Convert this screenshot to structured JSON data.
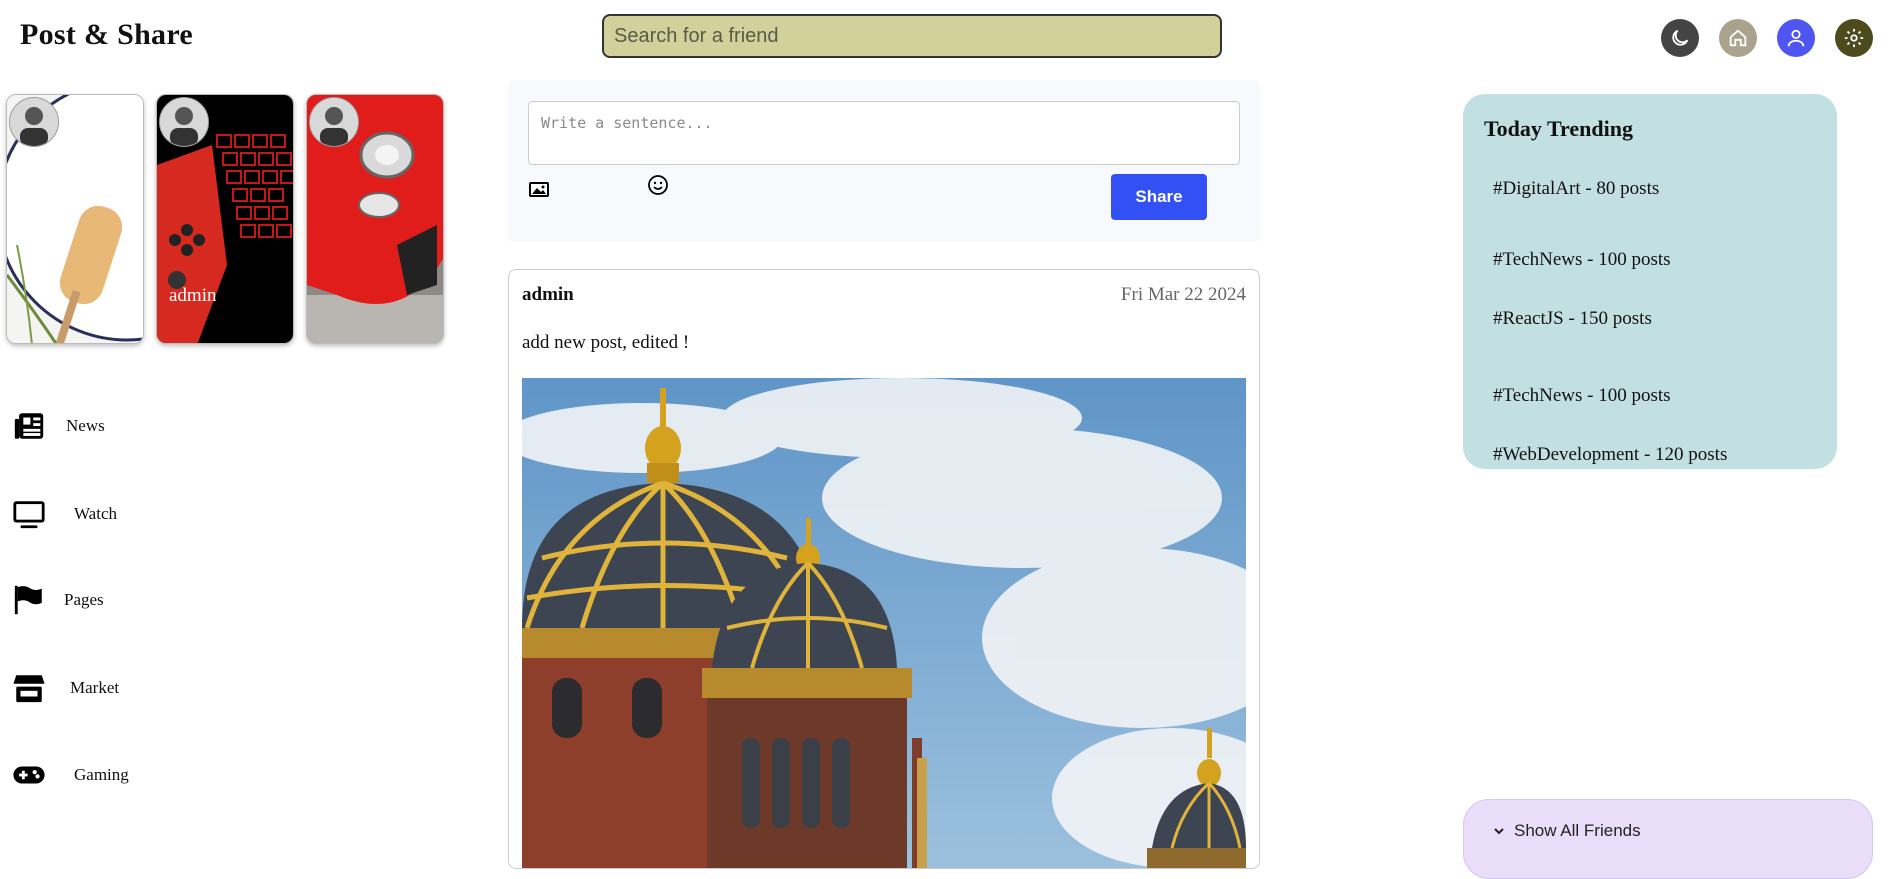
{
  "app": {
    "title": "Post & Share"
  },
  "search": {
    "placeholder": "Search for a friend"
  },
  "header_icons": [
    {
      "name": "dark-mode-icon",
      "color": "#444444"
    },
    {
      "name": "home-icon",
      "color": "#aaa28d"
    },
    {
      "name": "profile-icon",
      "color": "#4f55f0"
    },
    {
      "name": "settings-icon",
      "color": "#4d4b1e"
    }
  ],
  "stories": [
    {
      "name": "",
      "image": "popsicle-on-plate"
    },
    {
      "name": "admin",
      "image": "red-keyboard-gamepad"
    },
    {
      "name": "",
      "image": "red-car-headlight"
    }
  ],
  "nav": {
    "items": [
      {
        "label": "News",
        "icon": "newspaper-icon"
      },
      {
        "label": "Watch",
        "icon": "monitor-icon"
      },
      {
        "label": "Pages",
        "icon": "flag-icon"
      },
      {
        "label": "Market",
        "icon": "store-icon"
      },
      {
        "label": "Gaming",
        "icon": "gamepad-icon"
      }
    ]
  },
  "composer": {
    "placeholder": "Write a sentence...",
    "share_label": "Share",
    "image_icon": "image-icon",
    "emoji_icon": "emoji-icon",
    "accent": "#3350f5"
  },
  "post": {
    "author": "admin",
    "date": "Fri Mar 22 2024",
    "text": "add new post, edited !",
    "image": "golden-domed-synagogue"
  },
  "trending": {
    "title": "Today Trending",
    "items": [
      {
        "label": "#DigitalArt - 80 posts"
      },
      {
        "label": "#TechNews - 100 posts"
      },
      {
        "label": "#ReactJS - 150 posts"
      },
      {
        "label": "#TechNews - 100 posts"
      },
      {
        "label": "#WebDevelopment - 120 posts"
      }
    ]
  },
  "friends": {
    "label": "Show All Friends",
    "icon": "chevron-down-icon"
  }
}
